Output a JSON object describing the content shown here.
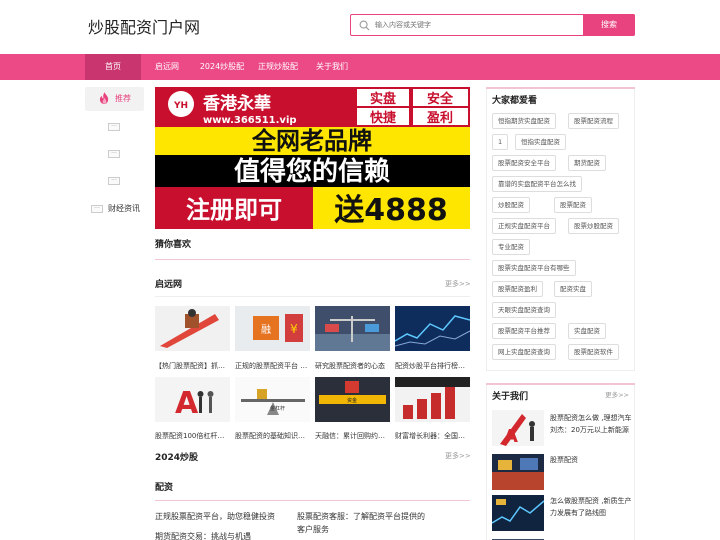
{
  "site": {
    "title": "炒股配资门户网"
  },
  "search": {
    "placeholder": "输入内容或关键字",
    "button_label": "搜索"
  },
  "nav": {
    "items": [
      "首页",
      "启远网",
      "2024炒股配",
      "正规炒股配",
      "关于我们"
    ]
  },
  "sidebar": {
    "recommend_label": "推荐",
    "dots": "···",
    "last_label": "财经资讯"
  },
  "banner": {
    "brand_logo_text": "香港永華",
    "url_text": "www.366511.vip",
    "badges": [
      "实盘",
      "安全",
      "快捷",
      "盈利"
    ],
    "line1": "全网老品牌",
    "line2": "值得您的信赖",
    "line3_left": "注册即可",
    "line3_right": "送4888"
  },
  "guess": {
    "title": "猜你喜欢"
  },
  "section1": {
    "title": "启远网",
    "more": "更多>>",
    "row1": [
      "【热门股票配资】抓…",
      "正规的股票配资平台 …",
      "研究股票配资者的心态",
      "配资炒股平台排行榜…"
    ],
    "row2": [
      "股票配资100倍杠杆平…",
      "股票配资的基础知识…",
      "天融信：累计回购约…",
      "财富增长利器：全国…"
    ]
  },
  "section2": {
    "title": "2024炒股",
    "more": "更多>>"
  },
  "section3": {
    "title": "配资",
    "links": [
      "正规股票配资平台，助您稳健投资",
      "股票配资客服：了解配资平台提供的",
      "客户服务",
      "期货配资交易：挑战与机遇"
    ]
  },
  "popular": {
    "title": "大家都爱看",
    "tags": [
      "恒指期货实盘配资",
      "股票配资流程",
      "1",
      "恒指实盘配资",
      "股票配资安全平台",
      "期货配资",
      "靠谱的实盘配资平台怎么找",
      "炒股配资",
      "股票配资",
      "正规实盘配资平台",
      "股票炒股配资",
      "专业配资",
      "股票实盘配资平台有哪些",
      "股票配资盈利",
      "配资实盘",
      "天眼实盘配资查询",
      "股票配资平台推荐",
      "实盘配资",
      "网上实盘配资查询",
      "股票配资软件"
    ]
  },
  "about": {
    "title": "关于我们",
    "more": "更多>>",
    "items": [
      "股票配资怎么做 ,理想汽车刘杰：20万元以上新能源",
      "股票配资",
      "怎么做股票配资 ,新质生产力发展有了路线图"
    ]
  },
  "colors": {
    "accent": "#ec4a87",
    "nav_active": "#c9366f"
  }
}
